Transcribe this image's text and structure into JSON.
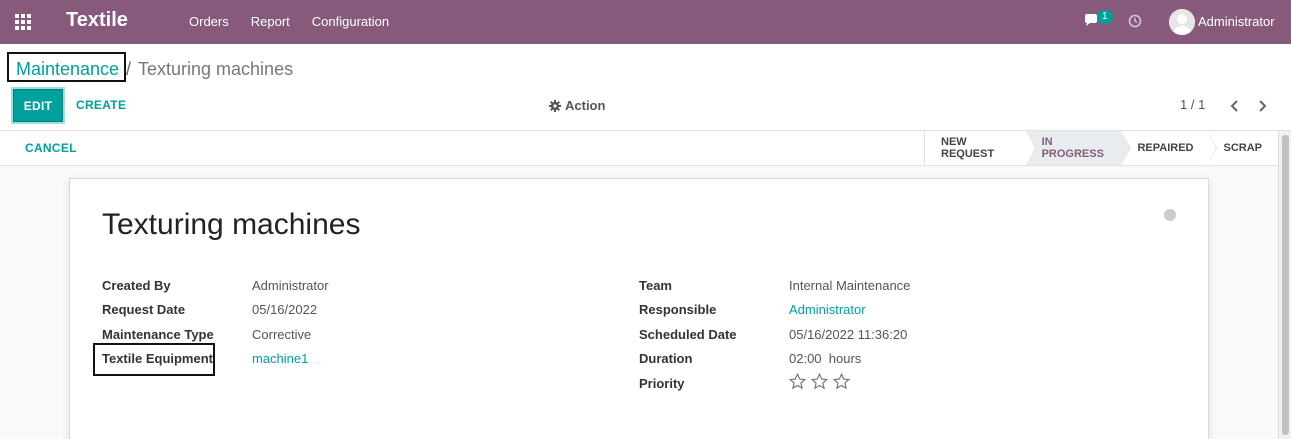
{
  "navbar": {
    "brand": "Textile",
    "menu": [
      "Orders",
      "Report",
      "Configuration"
    ],
    "chat_count": "1",
    "user_name": "Administrator",
    "bg_color": "#875a7b"
  },
  "breadcrumb": {
    "parent": "Maintenance",
    "separator": "/",
    "current": "Texturing machines"
  },
  "toolbar": {
    "edit_label": "EDIT",
    "create_label": "CREATE",
    "action_label": "Action",
    "pager": "1 / 1"
  },
  "statusbar": {
    "cancel_label": "CANCEL",
    "stages": [
      {
        "label": "NEW REQUEST",
        "active": false
      },
      {
        "label": "IN PROGRESS",
        "active": true
      },
      {
        "label": "REPAIRED",
        "active": false
      },
      {
        "label": "SCRAP",
        "active": false
      }
    ]
  },
  "record": {
    "title": "Texturing machines",
    "left_fields": [
      {
        "label": "Created By",
        "value": "Administrator",
        "link": false
      },
      {
        "label": "Request Date",
        "value": "05/16/2022",
        "link": false
      },
      {
        "label": "Maintenance Type",
        "value": "Corrective",
        "link": false
      },
      {
        "label": "Textile Equipment",
        "value": "machine1",
        "link": true
      }
    ],
    "right_fields": [
      {
        "label": "Team",
        "value": "Internal Maintenance",
        "link": false
      },
      {
        "label": "Responsible",
        "value": "Administrator",
        "link": true
      },
      {
        "label": "Scheduled Date",
        "value": "05/16/2022 11:36:20",
        "link": false
      },
      {
        "label": "Duration",
        "value": "02:00  hours",
        "link": false
      },
      {
        "label": "Priority",
        "value": "",
        "link": false
      }
    ],
    "priority_stars": 3,
    "priority_level": 0
  },
  "colors": {
    "accent": "#00a09d",
    "brand": "#875a7b"
  }
}
